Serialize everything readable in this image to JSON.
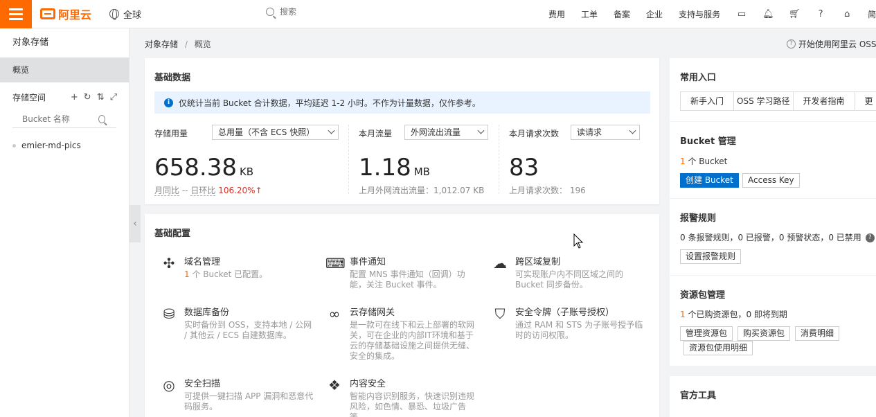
{
  "topbar": {
    "logo_text": "阿里云",
    "region": "全球",
    "search_placeholder": "搜索",
    "nav": [
      "费用",
      "工单",
      "备案",
      "企业",
      "支持与服务"
    ],
    "icons": [
      "terminal-icon",
      "bell-icon",
      "cart-icon",
      "help-icon",
      "home-icon"
    ],
    "truncated_label": "简"
  },
  "sidebar": {
    "title": "对象存储",
    "active_item": "概览",
    "section_label": "存储空间",
    "search_placeholder": "Bucket 名称",
    "buckets": [
      "emier-md-pics"
    ]
  },
  "breadcrumb": {
    "root": "对象存储",
    "separator": "/",
    "current": "概览"
  },
  "getting_started": "开始使用阿里云 OSS",
  "basic_data": {
    "title": "基础数据",
    "notice": "仅统计当前 Bucket 合计数据，平均延迟 1-2 小时。不作为计量数据，仅作参考。",
    "storage": {
      "label": "存储用量",
      "select": "总用量（不含 ECS 快照）",
      "value": "658.38",
      "unit": "KB",
      "yoy_label": "月同比",
      "yoy_value": "--",
      "mom_label": "日环比",
      "mom_value": "106.20%"
    },
    "traffic": {
      "label": "本月流量",
      "select": "外网流出流量",
      "value": "1.18",
      "unit": "MB",
      "sub": "上月外网流出流量：1,012.07 KB"
    },
    "requests": {
      "label": "本月请求次数",
      "select": "读请求",
      "value": "83",
      "sub": "上月请求次数：  196"
    }
  },
  "basic_config": {
    "title": "基础配置",
    "features": [
      {
        "title": "域名管理",
        "count": "1",
        "desc": " 个 Bucket 已配置。"
      },
      {
        "title": "事件通知",
        "desc": "配置 MNS 事件通知（回调）功能，关注 Bucket 事件。"
      },
      {
        "title": "跨区域复制",
        "desc": "可实现账户内不同区域之间的 Bucket 同步备份。"
      },
      {
        "title": "数据库备份",
        "desc": "实时备份到 OSS，支持本地 / 公网 / 其他云 / ECS 自建数据库。"
      },
      {
        "title": "云存储网关",
        "desc": "是一款可在线下和云上部署的软网关，可在企业的内部IT环境和基于云的存储基础设施之间提供无缝、安全的集成。"
      },
      {
        "title": "安全令牌（子账号授权）",
        "desc": "通过 RAM 和 STS 为子账号授予临时的访问权限。"
      },
      {
        "title": "安全扫描",
        "desc": "可提供一键扫描 APP 漏洞和恶意代码服务。"
      },
      {
        "title": "内容安全",
        "desc": "智能内容识别服务，快速识别违规风险，如色情、暴恐、垃圾广告等。"
      }
    ]
  },
  "right": {
    "entries_title": "常用入口",
    "entries": [
      "新手入门",
      "OSS 学习路径",
      "开发者指南",
      "更"
    ],
    "bucket_title": "Bucket 管理",
    "bucket_count": "1",
    "bucket_count_suffix": " 个 Bucket",
    "create_bucket": "创建 Bucket",
    "access_key": "Access Key",
    "alarm_title": "报警规则",
    "alarm_text": "0 条报警规则，0 已报警，0 预警状态，0 已禁用",
    "alarm_button": "设置报警规则",
    "package_title": "资源包管理",
    "package_count": "1",
    "package_text": " 个已购资源包，0 即将到期",
    "package_buttons": [
      "管理资源包",
      "购买资源包",
      "消费明细",
      "资源包使用明细"
    ],
    "tools_title": "官方工具"
  }
}
